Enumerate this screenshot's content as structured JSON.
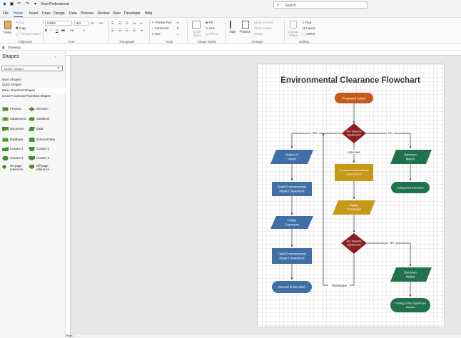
{
  "titlebar": {
    "app_title": "Visio Professional",
    "search_placeholder": "Search"
  },
  "menu": [
    "File",
    "Home",
    "Insert",
    "Draw",
    "Design",
    "Data",
    "Process",
    "Review",
    "View",
    "Developer",
    "Help"
  ],
  "ribbon": {
    "clipboard": {
      "paste": "Paste",
      "cut": "Cut",
      "copy": "Copy",
      "format_painter": "Format Painter",
      "label": "Clipboard"
    },
    "font": {
      "font_name": "Calibri",
      "font_size": "8pt.",
      "label": "Font"
    },
    "paragraph": {
      "label": "Paragraph"
    },
    "tools": {
      "pointer": "Pointer Tool",
      "connector": "Connector",
      "text": "Text",
      "label": "Tools"
    },
    "shape_styles": {
      "quick_styles": "Quick Styles",
      "fill": "Fill",
      "line": "Line",
      "effects": "Effects",
      "label": "Shape Styles"
    },
    "arrange": {
      "align": "Align",
      "position": "Position",
      "bring_front": "Bring to Front",
      "send_back": "Send to Back",
      "group": "Group",
      "label": "Arrange"
    },
    "editing": {
      "change_shape": "Change Shape",
      "find": "Find",
      "layers": "Layers",
      "select": "Select",
      "label": "Editing"
    }
  },
  "doc_tab": "Drawing1",
  "shapes_pane": {
    "title": "Shapes",
    "search_placeholder": "Search shapes",
    "more_shapes": "More Shapes",
    "quick_shapes": "Quick Shapes",
    "stencils": [
      "Basic Flowchart Shapes",
      "Cross-Functional Flowchart Shapes"
    ],
    "items": [
      [
        "Process",
        "Decision"
      ],
      [
        "Subprocess",
        "Start/End"
      ],
      [
        "Document",
        "Data"
      ],
      [
        "Database",
        "External Data"
      ],
      [
        "Custom 1",
        "Custom 2"
      ],
      [
        "Custom 3",
        "Custom 4"
      ],
      [
        "On-page reference",
        "Off-page reference"
      ]
    ]
  },
  "colors": {
    "orange": "#c55a1a",
    "darkred": "#8b1e1e",
    "blue": "#3f6fa6",
    "green": "#22714d",
    "gold": "#c69818",
    "accent": "#185abd"
  },
  "flowchart": {
    "title": "Environmental Clearance Flowchart",
    "nodes": {
      "proposed": "Proposed Action",
      "decision1": [
        "Are impacts",
        "significant?"
      ],
      "notice": [
        "Notice of",
        "Intent"
      ],
      "draft_eis": [
        "Draft Environmental",
        "Impact Statement"
      ],
      "public1": [
        "Public",
        "Comment"
      ],
      "final_eis": [
        "Final Environmental",
        "Impact Statement"
      ],
      "record": "Record of Decision",
      "conduct_ea": [
        "Conduct environmental",
        "assessment"
      ],
      "public2": [
        "Public",
        "Comment"
      ],
      "decision2": [
        "Are impacts",
        "significant?"
      ],
      "decision_memo": [
        "Decision",
        "Memo"
      ],
      "categorical": "Categorical Exclusion",
      "decision_notice": [
        "Decision",
        "Notice"
      ],
      "fonsi": [
        "Finding of No Significant",
        "Impact"
      ]
    },
    "edge_labels": {
      "yes": "Yes",
      "no": "No",
      "unknown": "Unknown",
      "no2": "No",
      "yes_maybe": "Yes/Maybe"
    }
  },
  "status": {
    "page_tab": "Page-1"
  }
}
